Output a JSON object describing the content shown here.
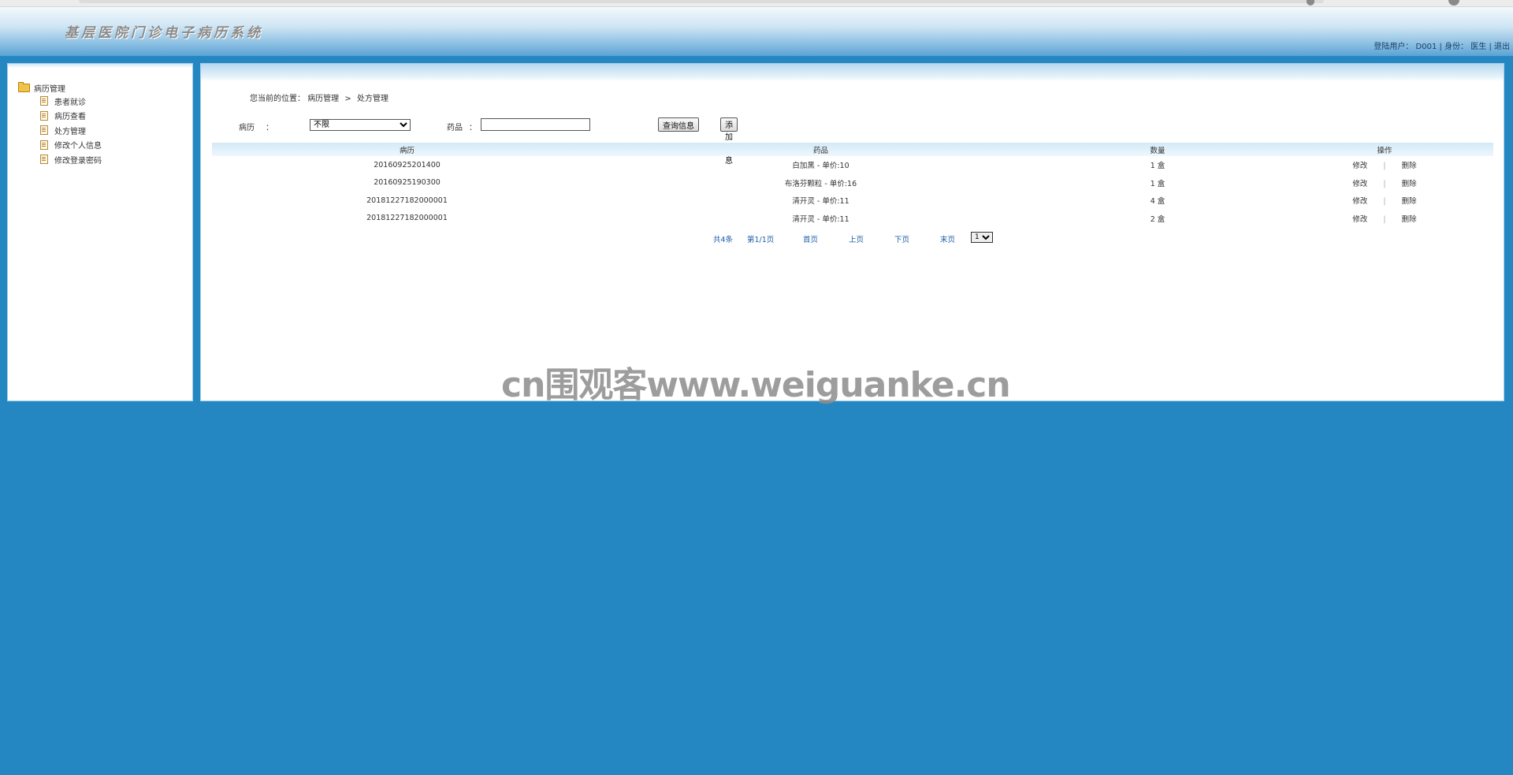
{
  "app": {
    "title": "基层医院门诊电子病历系统",
    "user_label": "登陆用户：",
    "user_id": "D001",
    "role_label": "身份：",
    "role": "医生",
    "logout": "退出"
  },
  "sidebar": {
    "root_label": "病历管理",
    "items": [
      {
        "label": "患者就诊"
      },
      {
        "label": "病历查看"
      },
      {
        "label": "处方管理"
      },
      {
        "label": "修改个人信息"
      },
      {
        "label": "修改登录密码"
      }
    ]
  },
  "breadcrumb": {
    "prefix": "您当前的位置：",
    "parent": "病历管理",
    "sep": ">",
    "current": "处方管理"
  },
  "filters": {
    "record_label": "病历",
    "record_colon": "：",
    "record_value": "不限",
    "drug_label": "药品",
    "drug_colon": "：",
    "drug_value": "",
    "query_button": "查询信息",
    "add_button": "添加信息"
  },
  "table": {
    "columns": [
      "病历",
      "药品",
      "数量",
      "操作"
    ],
    "rows": [
      {
        "record": "20160925201400",
        "drug": "白加黑 - 单价:10",
        "qty": "1 盒",
        "edit": "修改",
        "delete": "删除"
      },
      {
        "record": "20160925190300",
        "drug": "布洛芬颗粒 - 单价:16",
        "qty": "1 盒",
        "edit": "修改",
        "delete": "删除"
      },
      {
        "record": "20181227182000001",
        "drug": "清开灵 - 单价:11",
        "qty": "4 盒",
        "edit": "修改",
        "delete": "删除"
      },
      {
        "record": "20181227182000001",
        "drug": "清开灵 - 单价:11",
        "qty": "2 盒",
        "edit": "修改",
        "delete": "删除"
      }
    ]
  },
  "pager": {
    "total": "共4条",
    "page_info": "第1/1页",
    "first": "首页",
    "prev": "上页",
    "next": "下页",
    "last": "末页",
    "page_select": "1"
  },
  "watermark": "cn围观客www.weiguanke.cn"
}
